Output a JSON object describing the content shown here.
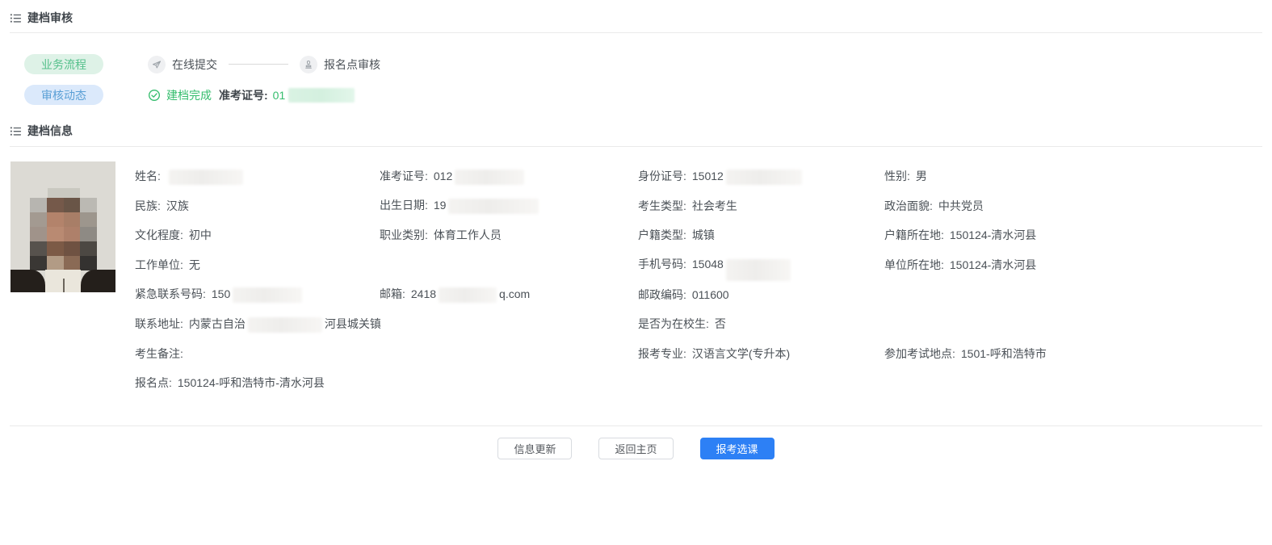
{
  "headers": {
    "review_title": "建档审核",
    "info_title": "建档信息"
  },
  "workflow": {
    "pill_process": "业务流程",
    "pill_status": "审核动态",
    "step_submit": "在线提交",
    "step_review": "报名点审核",
    "status_done": "建档完成",
    "ticket_label": "准考证号:",
    "ticket_visible": "01"
  },
  "icons": {
    "list": "list-icon",
    "send": "paper-plane-icon",
    "stamp": "stamp-icon",
    "check": "check-circle-icon"
  },
  "colors": {
    "status_green": "#35bd6d",
    "pill_green_bg": "#def2e7",
    "pill_green_text": "#55c08b",
    "pill_blue_bg": "#dbe9fb",
    "pill_blue_text": "#5ba0d6",
    "primary_blue": "#2d80f5",
    "text": "#4b5157",
    "divider": "#eaeaea"
  },
  "photo": {
    "bg": "#dcdad4",
    "light_block": "#c9c8c0",
    "hair": "#241f1b",
    "shirt": "#eae6dc",
    "mosaic": [
      [
        "#b7b5b0",
        "#75594a",
        "#695547",
        "#bbb9b3"
      ],
      [
        "#a39a91",
        "#b3836b",
        "#a87e67",
        "#9d968d"
      ],
      [
        "#a0938a",
        "#b98a72",
        "#ae806a",
        "#8e8a84"
      ],
      [
        "#57524d",
        "#7c5a46",
        "#6f5242",
        "#4c4843"
      ],
      [
        "#3a3734",
        "#b29b85",
        "#8a6a55",
        "#343230"
      ]
    ]
  },
  "info": {
    "fields": [
      {
        "key": "name",
        "col": 1,
        "row": 1,
        "label": "姓名:",
        "pre": "",
        "redact": 92,
        "post": ""
      },
      {
        "key": "admission-ticket-no",
        "col": 2,
        "row": 1,
        "label": "准考证号:",
        "pre": "012",
        "redact": 86,
        "post": ""
      },
      {
        "key": "id-card-no",
        "col": 3,
        "row": 1,
        "label": "身份证号:",
        "pre": "15012",
        "redact": 94,
        "post": ""
      },
      {
        "key": "gender",
        "col": 4,
        "row": 1,
        "label": "性别:",
        "pre": "男",
        "redact": 0,
        "post": ""
      },
      {
        "key": "ethnicity",
        "col": 1,
        "row": 2,
        "label": "民族:",
        "pre": "汉族",
        "redact": 0,
        "post": ""
      },
      {
        "key": "birth-date",
        "col": 2,
        "row": 2,
        "label": "出生日期:",
        "pre": "19",
        "redact": 112,
        "post": ""
      },
      {
        "key": "candidate-type",
        "col": 3,
        "row": 2,
        "label": "考生类型:",
        "pre": "社会考生",
        "redact": 0,
        "post": ""
      },
      {
        "key": "political-status",
        "col": 4,
        "row": 2,
        "label": "政治面貌:",
        "pre": "中共党员",
        "redact": 0,
        "post": ""
      },
      {
        "key": "education-level",
        "col": 1,
        "row": 3,
        "label": "文化程度:",
        "pre": "初中",
        "redact": 0,
        "post": ""
      },
      {
        "key": "occupation-category",
        "col": 2,
        "row": 3,
        "label": "职业类别:",
        "pre": "体育工作人员",
        "redact": 0,
        "post": ""
      },
      {
        "key": "household-type",
        "col": 3,
        "row": 3,
        "label": "户籍类型:",
        "pre": "城镇",
        "redact": 0,
        "post": ""
      },
      {
        "key": "household-location",
        "col": 4,
        "row": 3,
        "label": "户籍所在地:",
        "pre": "150124-清水河县",
        "redact": 0,
        "post": ""
      },
      {
        "key": "employer",
        "col": 1,
        "row": 4,
        "label": "工作单位:",
        "pre": "无",
        "redact": 0,
        "post": ""
      },
      {
        "key": "mobile-phone",
        "col": 3,
        "row": 4,
        "label": "手机号码:",
        "pre": "15048",
        "redact": 80,
        "post": "",
        "tall": true
      },
      {
        "key": "employer-location",
        "col": 4,
        "row": 4,
        "label": "单位所在地:",
        "pre": "150124-清水河县",
        "redact": 0,
        "post": ""
      },
      {
        "key": "emergency-contact",
        "col": 1,
        "row": 5,
        "label": "紧急联系号码:",
        "pre": "150",
        "redact": 86,
        "post": ""
      },
      {
        "key": "email",
        "col": 2,
        "row": 5,
        "label": "邮箱:",
        "pre": "2418",
        "redact": 72,
        "post": "q.com"
      },
      {
        "key": "postal-code",
        "col": 3,
        "row": 5,
        "label": "邮政编码:",
        "pre": "011600",
        "redact": 0,
        "post": ""
      },
      {
        "key": "contact-address",
        "col": 1,
        "row": 6,
        "label": "联系地址:",
        "pre": "内蒙古自治",
        "redact": 92,
        "post": "河县城关镇"
      },
      {
        "key": "is-current-student",
        "col": 3,
        "row": 6,
        "label": "是否为在校生:",
        "pre": "否",
        "redact": 0,
        "post": ""
      },
      {
        "key": "candidate-remarks",
        "col": 1,
        "row": 7,
        "label": "考生备注:",
        "pre": "",
        "redact": 0,
        "post": ""
      },
      {
        "key": "applied-major",
        "col": 3,
        "row": 7,
        "label": "报考专业:",
        "pre": "汉语言文学(专升本)",
        "redact": 0,
        "post": ""
      },
      {
        "key": "exam-location",
        "col": 4,
        "row": 7,
        "label": "参加考试地点:",
        "pre": "1501-呼和浩特市",
        "redact": 0,
        "post": ""
      },
      {
        "key": "registration-point",
        "col": 1,
        "row": 8,
        "label": "报名点:",
        "pre": "150124-呼和浩特市-清水河县",
        "redact": 0,
        "post": ""
      }
    ]
  },
  "buttons": [
    {
      "label": "信息更新",
      "type": "default"
    },
    {
      "label": "返回主页",
      "type": "default"
    },
    {
      "label": "报考选课",
      "type": "primary"
    }
  ]
}
